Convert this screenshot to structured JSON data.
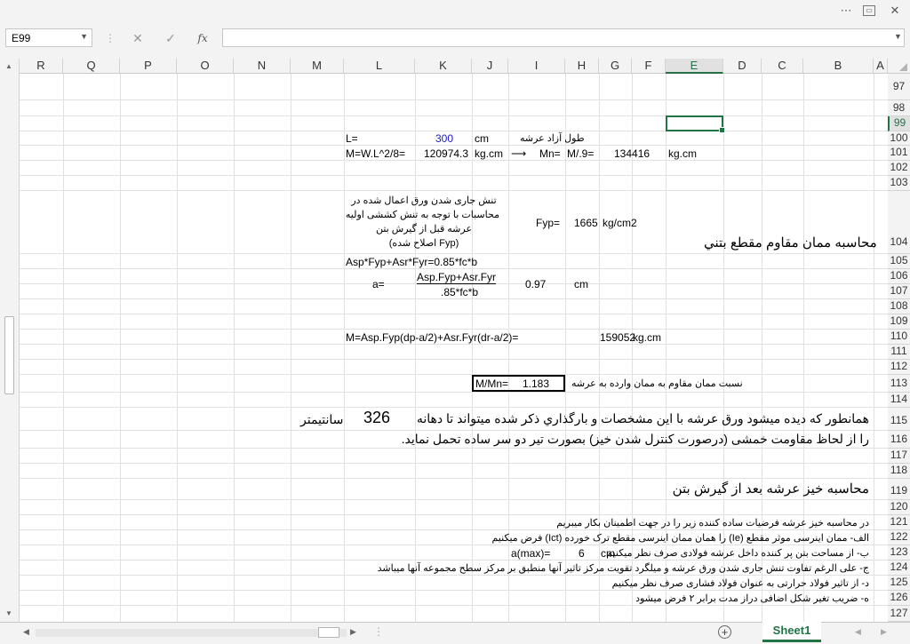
{
  "window": {
    "icons": [
      "more-icon",
      "restore-icon",
      "close-icon"
    ]
  },
  "formula_bar": {
    "name_box": "E99",
    "fx_label": "fx",
    "formula": ""
  },
  "columns": [
    "A",
    "B",
    "C",
    "D",
    "E",
    "F",
    "G",
    "H",
    "I",
    "J",
    "K",
    "L",
    "M",
    "N",
    "O",
    "P",
    "Q",
    "R"
  ],
  "selected_column": "E",
  "rows": [
    "97",
    "98",
    "99",
    "100",
    "101",
    "102",
    "103",
    "104",
    "105",
    "106",
    "107",
    "108",
    "109",
    "110",
    "111",
    "112",
    "113",
    "114",
    "115",
    "116",
    "117",
    "118",
    "119",
    "120",
    "121",
    "122",
    "123",
    "124",
    "125",
    "126",
    "127"
  ],
  "selected_row": "99",
  "cells": {
    "r100_L": "L=",
    "r100_K": "300",
    "r100_J": "cm",
    "r100_note": "طول آزاد عرشه",
    "r101_L": "M=W.L^2/8=",
    "r101_K": "120974.3",
    "r101_J": "kg.cm",
    "r101_arrow": "⟶",
    "r101_I": "Mn=",
    "r101_H": "M/.9=",
    "r101_G": "134416",
    "r101_E": "kg.cm",
    "r104_note1": "تنش جاری شدن ورق اعمال شده در",
    "r104_note2": "محاسبات با توجه به تنش کششی اولیه",
    "r104_note3": "عرشه قبل از گیرش بتن",
    "r104_note4": "(Fyp اصلاح شده)",
    "r104_fyp_label": "Fyp=",
    "r104_fyp_value": "1665",
    "r104_fyp_unit": "kg/cm2",
    "r104_heading": "محاسبه ممان مقاوم مقطع بتني",
    "r105_formula": "Asp*Fyp+Asr*Fyr=0.85*fc*b",
    "r106_a": "a=",
    "r106_num": "Asp.Fyp+Asr.Fyr",
    "r107_den": ".85*fc*b",
    "r106_val": "0.97",
    "r106_unit": "cm",
    "r110_formula": "M=Asp.Fyp(dp-a/2)+Asr.Fyr(dr-a/2)=",
    "r110_value": "159052",
    "r110_unit": "kg.cm",
    "r113_ratio_label": "M/Mn=",
    "r113_ratio_value": "1.183",
    "r113_note": "نسبت ممان مقاوم به ممان وارده به عرشه",
    "r115_text": "همانطور که دیده میشود ورق عرشه با این مشخصات و بارگذاري ذکر شده میتواند تا دهانه",
    "r115_value": "326",
    "r115_unit": "سانتيمتر",
    "r116_text": "را از لحاظ مقاومت خمشی (درصورت کنترل شدن خیز) بصورت تیر دو سر ساده تحمل نماید.",
    "r119_heading": "محاسبه خیز عرشه بعد از گیرش بتن",
    "r121_text": "در محاسبه خیز عرشه فرضیات ساده کننده زیر را در جهت اطمینان بکار میبریم",
    "r122_text": "الف- ممان اینرسی موثر مقطع (Ie) را همان ممان اینرسی مقطع ترک خورده (Ict) فرض میکنیم",
    "r123_text": "ب- از مساحت بتن پر کننده داخل عرشه فولادی صرف نظر میکنیم",
    "r123_label": "a(max)=",
    "r123_value": "6",
    "r123_unit": "cm",
    "r124_text": "ج- علی الرغم تفاوت تنش جاری شدن ورق عرشه و میلگرد تقویت مرکز تاثیر آنها منطبق بر مرکز سطح مجموعه آنها میباشد",
    "r125_text": "د- از تاثیر فولاد حرارتی به عنوان فولاد فشاری صرف نظر میکنیم",
    "r126_text": "ه- ضریب تغیر شکل اضافی دراز مدت برابر ۲ فرض میشود"
  },
  "sheet_tab": "Sheet1",
  "colors": {
    "accent": "#217346",
    "value_blue": "#1a1acc",
    "grid": "#e1e1e1"
  }
}
